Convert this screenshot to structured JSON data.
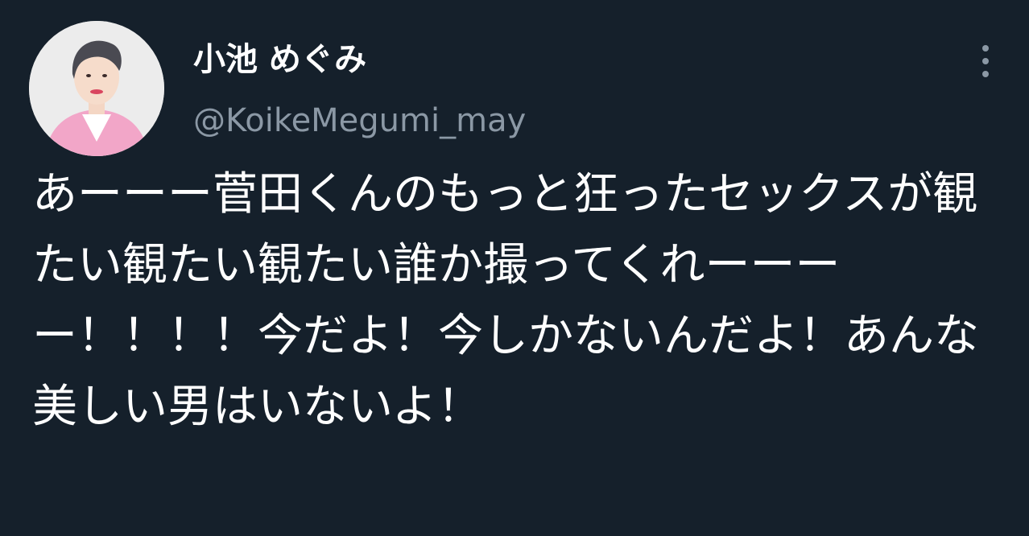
{
  "tweet": {
    "author": {
      "display_name": "小池 めぐみ",
      "handle": "@KoikeMegumi_may",
      "avatar_icon": "profile-photo"
    },
    "more_icon": "more-options-icon",
    "text": "あーーー菅田くんのもっと狂ったセックスが観たい観たい観たい誰か撮ってくれーーーー！！！！今だよ！今しかないんだよ！あんな美しい男はいないよ！"
  },
  "colors": {
    "background": "#15202b",
    "primary_text": "#ffffff",
    "secondary_text": "#8b98a5",
    "jacket_pink": "#f2a6c8"
  }
}
